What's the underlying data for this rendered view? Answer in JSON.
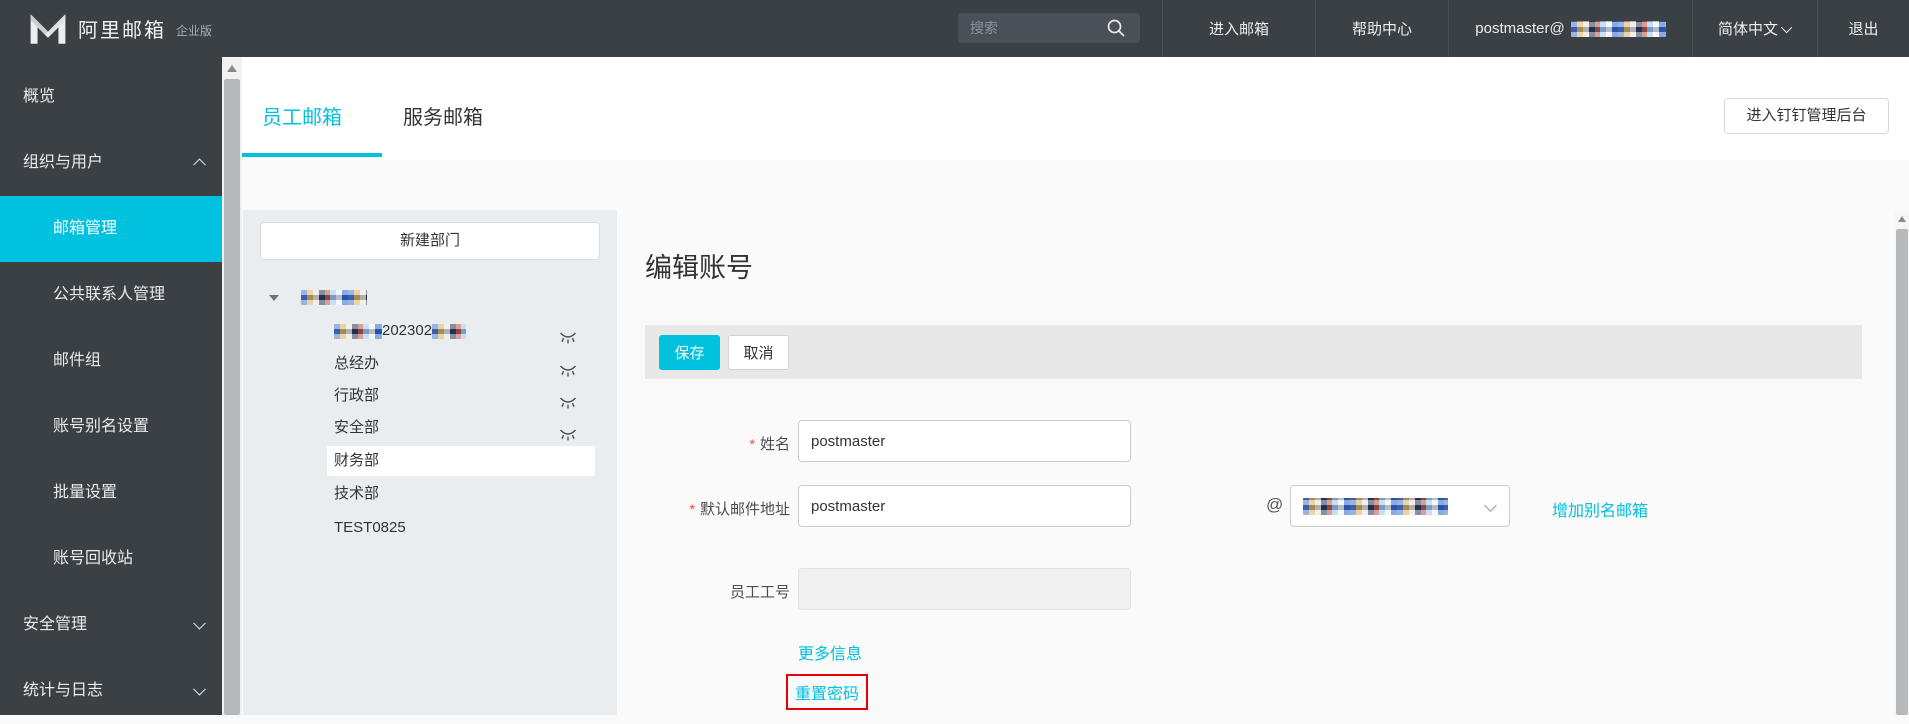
{
  "colors": {
    "accent": "#00c1de",
    "dark": "#3b4045",
    "annotation_red": "#e60000"
  },
  "topbar": {
    "logo_text": "阿里邮箱",
    "logo_badge": "企业版",
    "search_placeholder": "搜索",
    "enter_mailbox": "进入邮箱",
    "help_center": "帮助中心",
    "account_prefix": "postmaster@",
    "account_domain_redacted": true,
    "language": "简体中文",
    "logout": "退出"
  },
  "sidebar": {
    "items": [
      {
        "label": "概览",
        "level": 1
      },
      {
        "label": "组织与用户",
        "level": 1,
        "chevron": "up"
      },
      {
        "label": "邮箱管理",
        "level": 2,
        "active": true
      },
      {
        "label": "公共联系人管理",
        "level": 2
      },
      {
        "label": "邮件组",
        "level": 2
      },
      {
        "label": "账号别名设置",
        "level": 2
      },
      {
        "label": "批量设置",
        "level": 2
      },
      {
        "label": "账号回收站",
        "level": 2
      },
      {
        "label": "安全管理",
        "level": 1,
        "chevron": "down"
      },
      {
        "label": "统计与日志",
        "level": 1,
        "chevron": "down"
      }
    ]
  },
  "main": {
    "tabs": [
      {
        "label": "员工邮箱",
        "active": true
      },
      {
        "label": "服务邮箱",
        "active": false
      }
    ],
    "dingtalk_button": "进入钉钉管理后台"
  },
  "tree": {
    "new_department_button": "新建部门",
    "root": {
      "redacted": true
    },
    "children": [
      {
        "redacted_prefix": true,
        "visible_fragment": "202302",
        "redacted_suffix": true,
        "eye_icon": true
      },
      {
        "label": "总经办",
        "eye_icon": true
      },
      {
        "label": "行政部",
        "eye_icon": true
      },
      {
        "label": "安全部",
        "eye_icon": true
      },
      {
        "label": "财务部",
        "selected": true
      },
      {
        "label": "技术部"
      },
      {
        "label": "TEST0825"
      }
    ]
  },
  "form": {
    "title": "编辑账号",
    "save_button": "保存",
    "cancel_button": "取消",
    "name_field": {
      "required_mark": "*",
      "label": "姓名",
      "value": "postmaster"
    },
    "email_field": {
      "required_mark": "*",
      "label": "默认邮件地址",
      "value": "postmaster",
      "at_symbol": "@",
      "domain_redacted": true,
      "add_alias_link": "增加别名邮箱"
    },
    "employee_id_field": {
      "label": "员工工号",
      "value": ""
    },
    "more_info_link": "更多信息",
    "reset_password_link": "重置密码"
  }
}
